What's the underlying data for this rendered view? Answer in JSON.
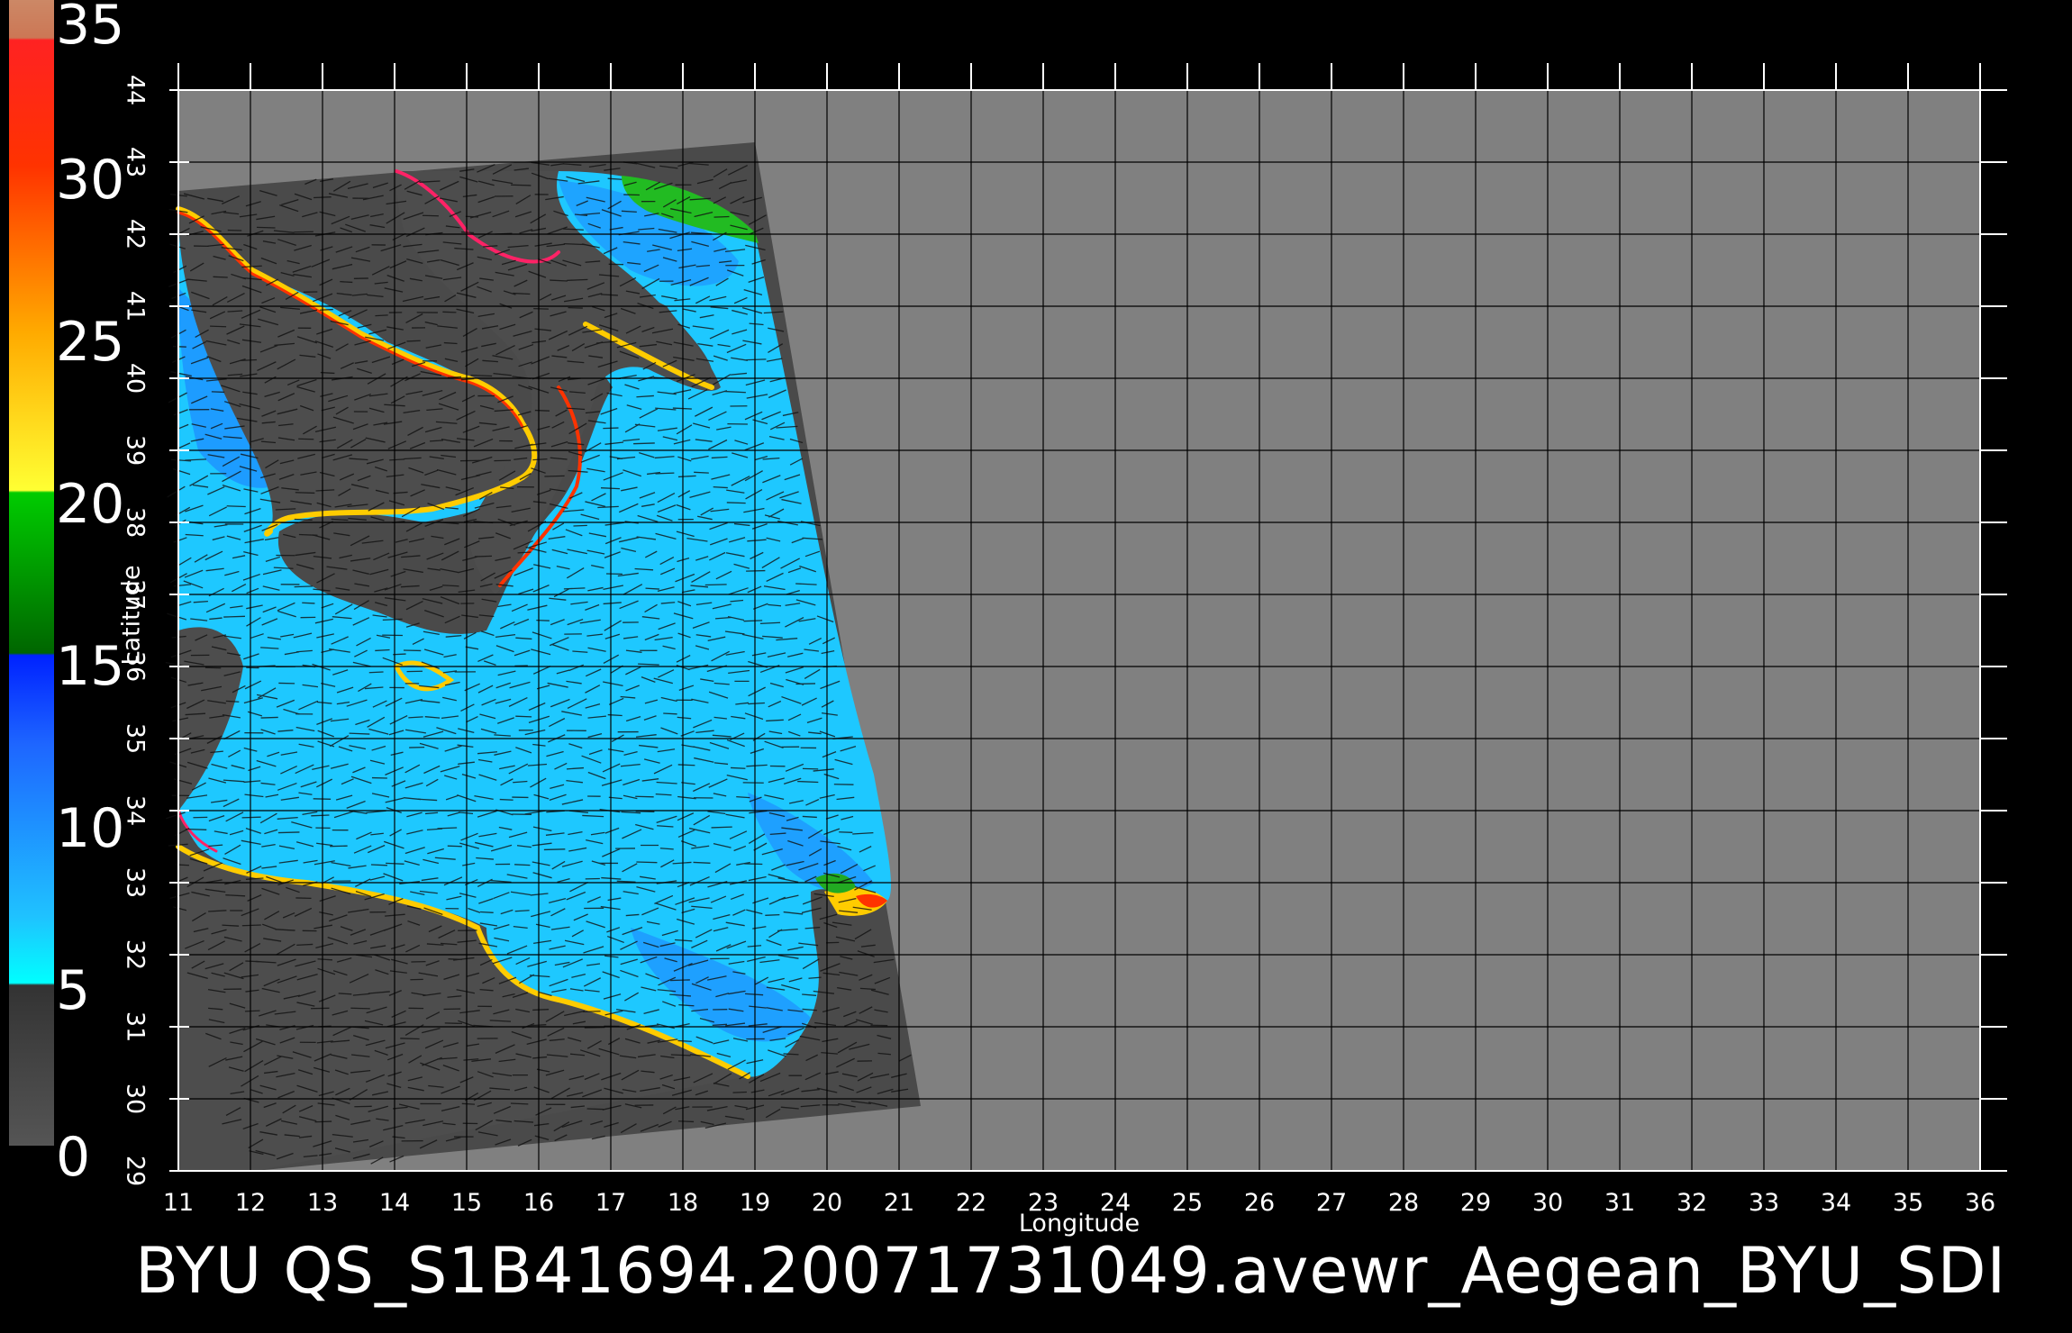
{
  "colorbar": {
    "labels": [
      "35",
      "30",
      "25",
      "20",
      "15",
      "10",
      "5",
      "0"
    ],
    "min": 0,
    "max": 35
  },
  "axes": {
    "x_title": "Longitude",
    "y_title": "Latitude",
    "lon_ticks": [
      11,
      12,
      13,
      14,
      15,
      16,
      17,
      18,
      19,
      20,
      21,
      22,
      23,
      24,
      25,
      26,
      27,
      28,
      29,
      30,
      31,
      32,
      33,
      34,
      35,
      36
    ],
    "lat_ticks": [
      29,
      30,
      31,
      32,
      33,
      34,
      35,
      36,
      37,
      38,
      39,
      40,
      41,
      42,
      43,
      44
    ]
  },
  "footer": {
    "title": "BYU  QS_S1B41694.20071731049.avewr_Aegean_BYU_SDI"
  },
  "colors": {
    "background": "#000000",
    "plot_gray": "#808080",
    "swath_gray": "#4a4a4a",
    "land_gray": "#555555",
    "sea_cyan": "#1ec8ff",
    "sea_blue": "#1e78ff",
    "grid": "#000000"
  }
}
